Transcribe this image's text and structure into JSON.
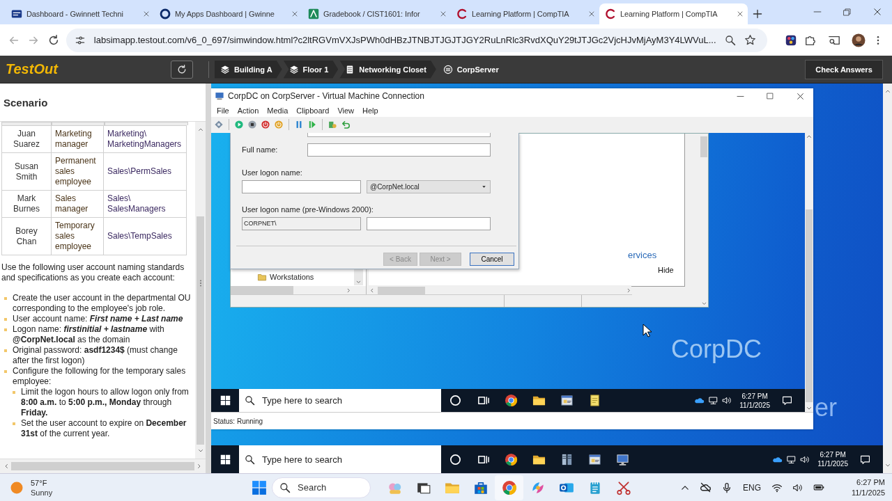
{
  "browser": {
    "tabs": [
      {
        "title": "Dashboard - Gwinnett Techni",
        "selected": false
      },
      {
        "title": "My Apps Dashboard | Gwinne",
        "selected": false
      },
      {
        "title": "Gradebook / CIST1601: Infor",
        "selected": false
      },
      {
        "title": "Learning Platform | CompTIA",
        "selected": false
      },
      {
        "title": "Learning Platform | CompTIA",
        "selected": true
      }
    ],
    "url": "labsimapp.testout.com/v6_0_697/simwindow.html?c2ltRGVmVXJsPWh0dHBzJTNBJTJGJTJGY2RuLnRlc3RvdXQuY29tJTJGc2VjcHJvMjAyM3Y4LWVuL..."
  },
  "lab_toolbar": {
    "logo": "TestOut",
    "breadcrumbs": [
      "Building A",
      "Floor 1",
      "Networking Closet",
      "CorpServer"
    ],
    "check_answers": "Check Answers"
  },
  "scenario": {
    "title": "Scenario",
    "table_rows": [
      {
        "name": "Juan Suarez",
        "role": "Marketing manager",
        "ou": "Marketing\\\nMarketingManagers"
      },
      {
        "name": "Susan Smith",
        "role": "Permanent sales employee",
        "ou": "Sales\\PermSales"
      },
      {
        "name": "Mark Burnes",
        "role": "Sales manager",
        "ou": "Sales\\\nSalesManagers"
      },
      {
        "name": "Borey Chan",
        "role": "Temporary sales employee",
        "ou": "Sales\\TempSales"
      }
    ],
    "intro": "Use the following user account naming standards and specifications as you create each account:",
    "bullets": [
      {
        "text": "Create the user account in the departmental OU corresponding to the employee's job role."
      },
      {
        "text": "User account name: *First name + Last name*"
      },
      {
        "text": "Logon name: *firstinitial + lastname* with **@CorpNet.local** as the domain"
      },
      {
        "text": "Original password: **asdf1234$** (must change after the first logon)"
      },
      {
        "text": "Configure the following for the temporary sales employee:",
        "children": [
          {
            "text": "Limit the logon hours to allow logon only from **8:00 a.m.** to **5:00 p.m., Monday** through **Friday.**"
          },
          {
            "text": "Set the user account to expire on **December 31st** of the current year."
          }
        ]
      }
    ]
  },
  "vm_window": {
    "title": "CorpDC on CorpServer - Virtual Machine Connection",
    "menu": [
      "File",
      "Action",
      "Media",
      "Clipboard",
      "View",
      "Help"
    ],
    "dialog": {
      "full_name_label": "Full name:",
      "logon_label": "User logon name:",
      "domain": "@CorpNet.local",
      "pre2000_label": "User logon name (pre-Windows 2000):",
      "domain_prefix": "CORPNET\\",
      "buttons": [
        {
          "label": "< Back",
          "disabled": true
        },
        {
          "label": "Next >",
          "disabled": true
        },
        {
          "label": "Cancel",
          "disabled": false
        }
      ]
    },
    "tree_item": "Workstations",
    "link": "ervices",
    "hide": "Hide",
    "desktop_label": "CorpDC",
    "taskbar": {
      "search_placeholder": "Type here to search",
      "time": "6:27 PM",
      "date": "11/1/2025"
    },
    "status": "Status: Running"
  },
  "host": {
    "desktop_label": "er",
    "taskbar": {
      "search_placeholder": "Type here to search",
      "time": "6:27 PM",
      "date": "11/1/2025"
    }
  },
  "system_taskbar": {
    "temperature": "57°F",
    "weather": "Sunny",
    "search_placeholder": "Search",
    "language": "ENG",
    "time": "6:27 PM",
    "date": "11/1/2025"
  }
}
